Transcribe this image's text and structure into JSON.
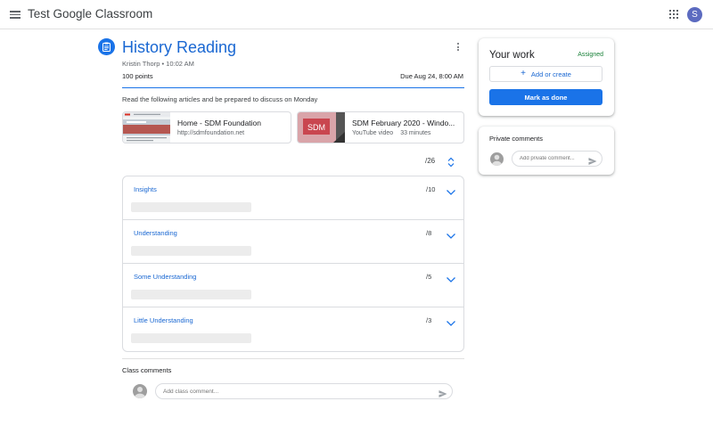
{
  "app": {
    "title": "Test Google Classroom",
    "avatar_letter": "S"
  },
  "assignment": {
    "title": "History Reading",
    "meta": "Kristin Thorp • 10:02 AM",
    "points": "100 points",
    "due": "Due Aug 24, 8:00 AM",
    "instructions": "Read the following articles and be prepared to discuss on Monday"
  },
  "attachments": [
    {
      "title": "Home - SDM Foundation",
      "subtitle": "http://sdmfoundation.net"
    },
    {
      "title": "SDM February 2020 - Windo...",
      "subtitle": "YouTube video",
      "duration": "33 minutes",
      "thumb_text": "SDM"
    }
  ],
  "rubric": {
    "total": "/26",
    "criteria": [
      {
        "name": "Insights",
        "points": "/10"
      },
      {
        "name": "Understanding",
        "points": "/8"
      },
      {
        "name": "Some Understanding",
        "points": "/5"
      },
      {
        "name": "Little Understanding",
        "points": "/3"
      }
    ]
  },
  "class_comments": {
    "label": "Class comments",
    "placeholder": "Add class comment..."
  },
  "your_work": {
    "title": "Your work",
    "status": "Assigned",
    "add_label": "Add or create",
    "done_label": "Mark as done"
  },
  "private_comments": {
    "label": "Private comments",
    "placeholder": "Add private comment..."
  },
  "colors": {
    "accent": "#1a73e8",
    "link": "#1967d2",
    "status_green": "#188038"
  },
  "icons": [
    "menu-icon",
    "apps-icon",
    "assignment-icon",
    "more-vert-icon",
    "expand-icon",
    "chevron-down-icon",
    "send-icon",
    "plus-icon"
  ]
}
